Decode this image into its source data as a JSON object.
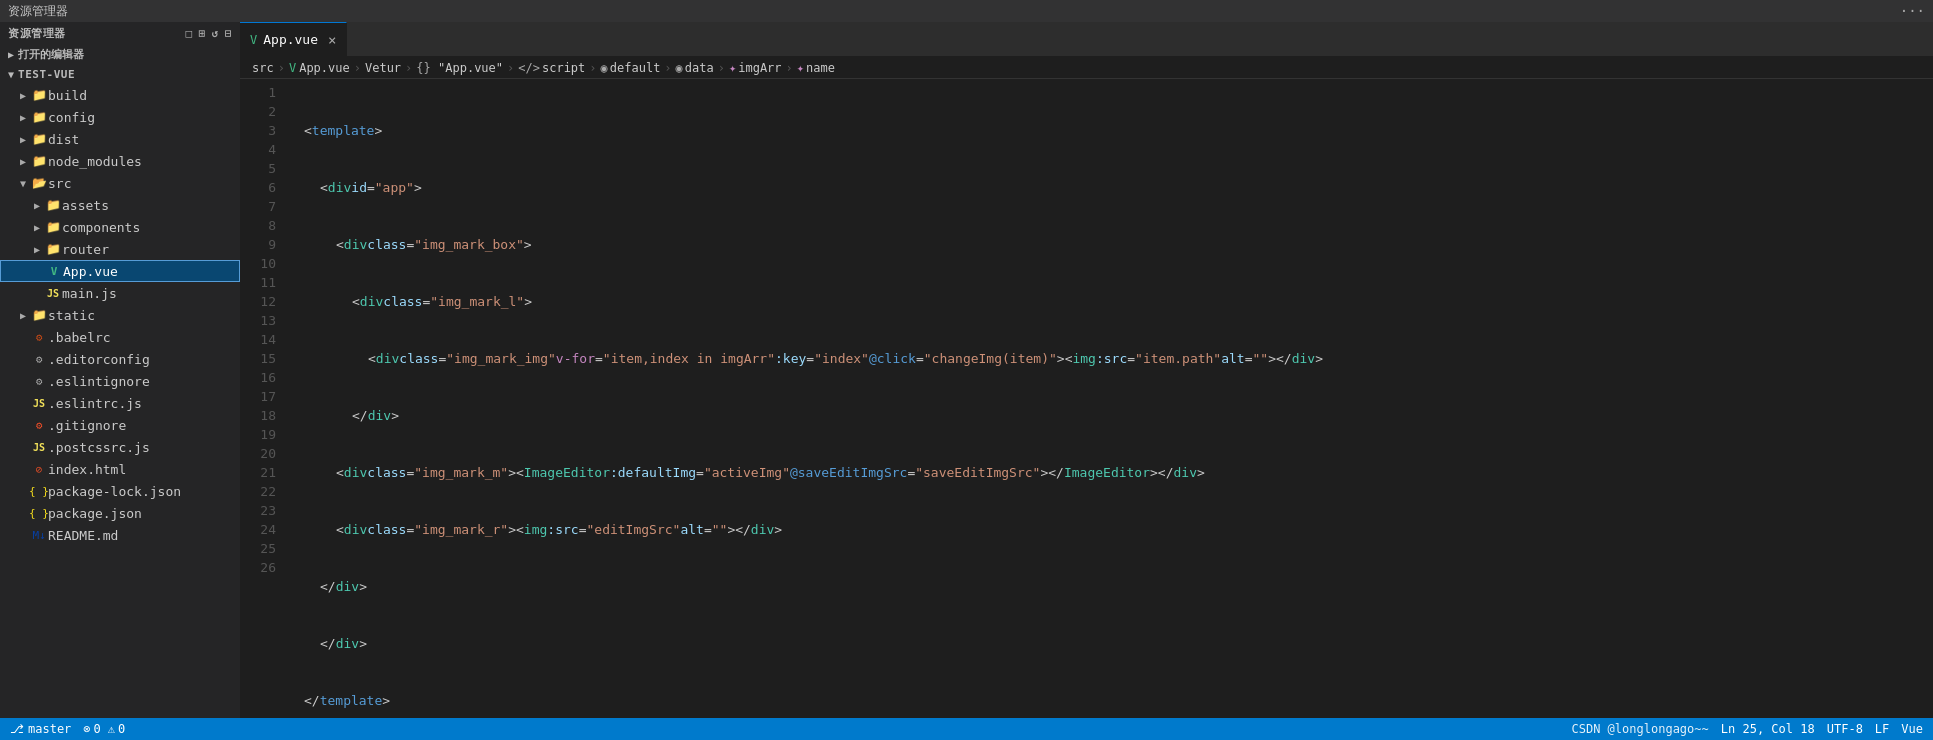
{
  "titlebar": {
    "title": "资源管理器",
    "menu_icon": "···"
  },
  "sidebar": {
    "header": "资源管理器",
    "open_editors_label": "打开的编辑器",
    "project_label": "TEST-VUE",
    "icons": [
      "new-file",
      "new-folder",
      "refresh",
      "collapse"
    ],
    "tree": [
      {
        "id": "build",
        "label": "build",
        "level": 1,
        "type": "folder",
        "expanded": false
      },
      {
        "id": "config",
        "label": "config",
        "level": 1,
        "type": "folder",
        "expanded": false
      },
      {
        "id": "dist",
        "label": "dist",
        "level": 1,
        "type": "folder",
        "expanded": false
      },
      {
        "id": "node_modules",
        "label": "node_modules",
        "level": 1,
        "type": "folder",
        "expanded": false
      },
      {
        "id": "src",
        "label": "src",
        "level": 1,
        "type": "folder",
        "expanded": true
      },
      {
        "id": "assets",
        "label": "assets",
        "level": 2,
        "type": "folder",
        "expanded": false
      },
      {
        "id": "components",
        "label": "components",
        "level": 2,
        "type": "folder",
        "expanded": false
      },
      {
        "id": "router",
        "label": "router",
        "level": 2,
        "type": "folder",
        "expanded": false
      },
      {
        "id": "App.vue",
        "label": "App.vue",
        "level": 2,
        "type": "vue",
        "active": true
      },
      {
        "id": "main.js",
        "label": "main.js",
        "level": 2,
        "type": "js"
      },
      {
        "id": "static",
        "label": "static",
        "level": 1,
        "type": "folder",
        "expanded": false
      },
      {
        "id": ".babelrc",
        "label": ".babelrc",
        "level": 1,
        "type": "config"
      },
      {
        "id": ".editorconfig",
        "label": ".editorconfig",
        "level": 1,
        "type": "config"
      },
      {
        "id": ".eslintignore",
        "label": ".eslintignore",
        "level": 1,
        "type": "config"
      },
      {
        "id": ".eslintrc.js",
        "label": ".eslintrc.js",
        "level": 1,
        "type": "js"
      },
      {
        "id": ".gitignore",
        "label": ".gitignore",
        "level": 1,
        "type": "config"
      },
      {
        "id": ".postcssrc.js",
        "label": ".postcssrc.js",
        "level": 1,
        "type": "js"
      },
      {
        "id": "index.html",
        "label": "index.html",
        "level": 1,
        "type": "html"
      },
      {
        "id": "package-lock.json",
        "label": "package-lock.json",
        "level": 1,
        "type": "json"
      },
      {
        "id": "package.json",
        "label": "package.json",
        "level": 1,
        "type": "json"
      },
      {
        "id": "README.md",
        "label": "README.md",
        "level": 1,
        "type": "md"
      }
    ]
  },
  "editor": {
    "tab_label": "App.vue",
    "breadcrumb": [
      "src",
      "App.vue",
      "Vetur",
      "{} \"App.vue\"",
      "script",
      "default",
      "data",
      "imgArr",
      "name"
    ],
    "filename": "App.vue"
  },
  "statusbar": {
    "branch": "master",
    "errors": "0",
    "warnings": "0",
    "encoding": "UTF-8",
    "line_ending": "LF",
    "language": "Vue",
    "line": "25",
    "col": "18",
    "watermark": "CSDN @longlongago~~"
  }
}
